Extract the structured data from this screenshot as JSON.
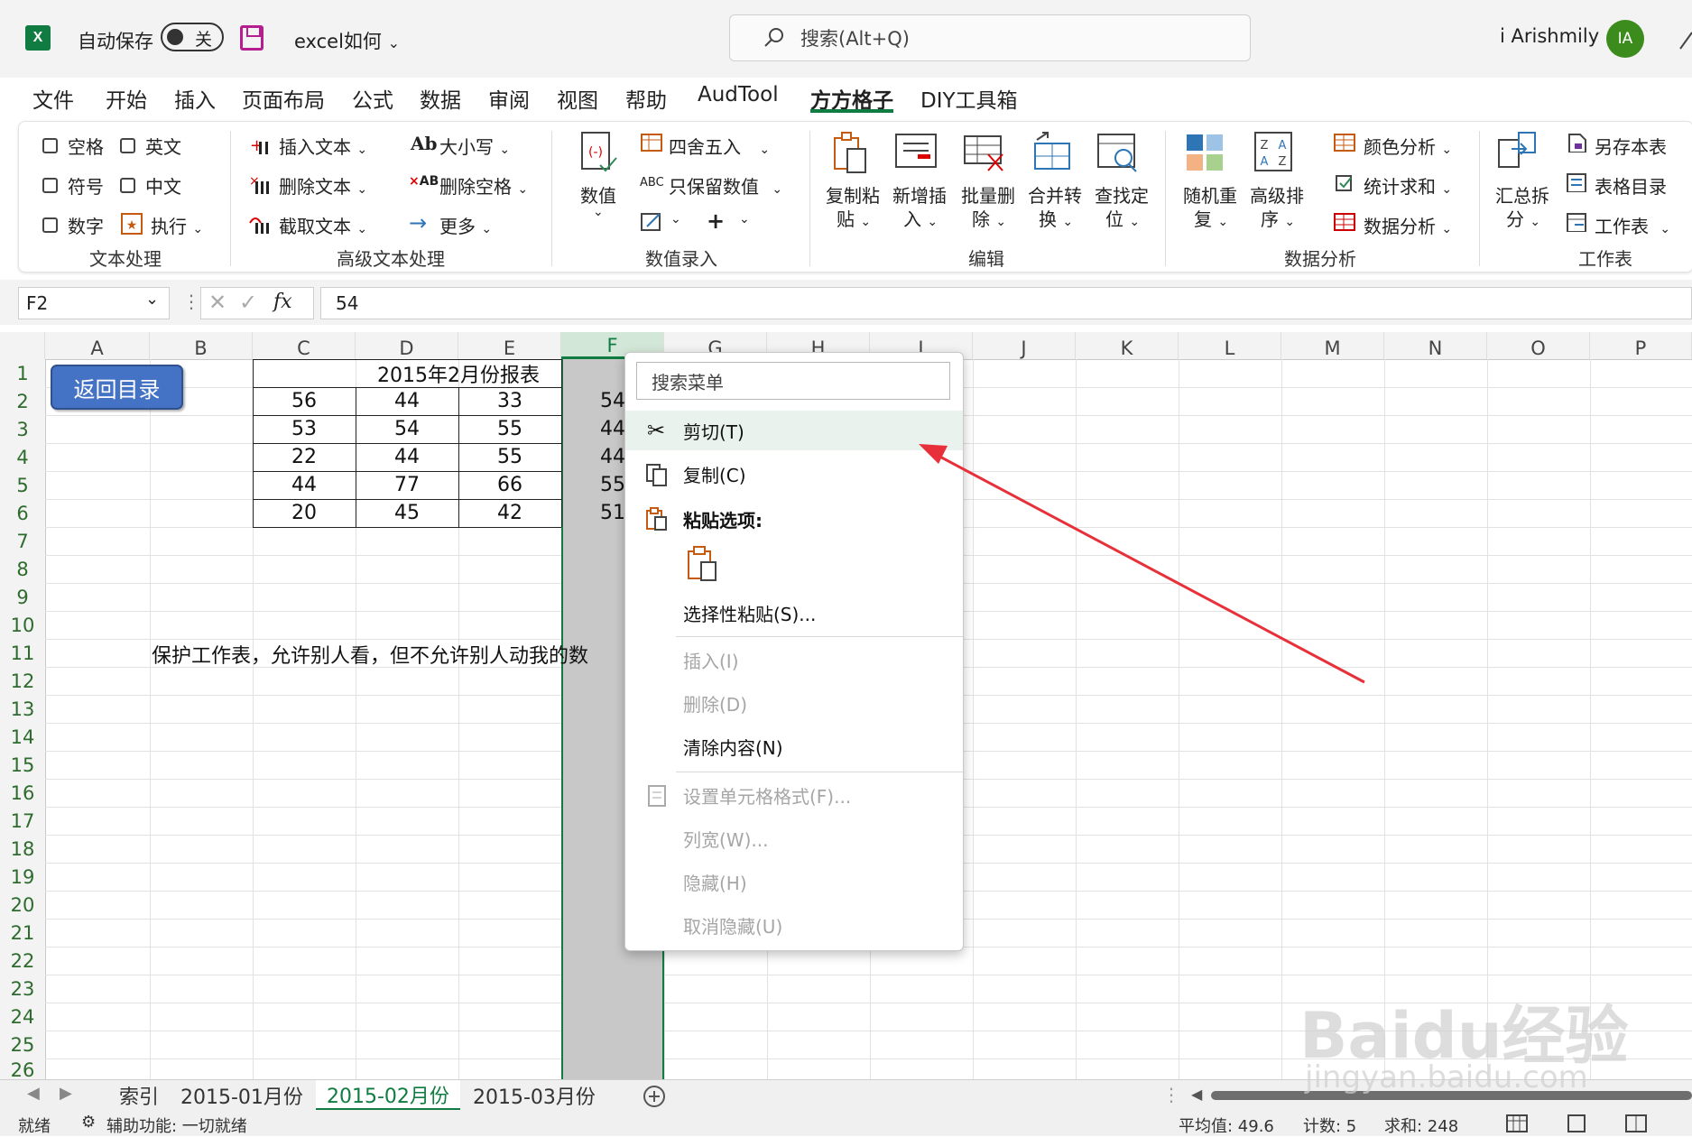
{
  "title_bar": {
    "app_badge": "X",
    "autosave_label": "自动保存",
    "autosave_state": "关",
    "file_name": "excel如何",
    "search_placeholder": "搜索(Alt+Q)",
    "user_name": "i Arishmily",
    "user_initials": "IA"
  },
  "menu_tabs": [
    "文件",
    "开始",
    "插入",
    "页面布局",
    "公式",
    "数据",
    "审阅",
    "视图",
    "帮助",
    "AudTool",
    "方方格子",
    "DIY工具箱"
  ],
  "active_menu_tab": "方方格子",
  "ribbon": {
    "text_processing": {
      "items": [
        "空格",
        "英文",
        "符号",
        "中文",
        "数字",
        "执行"
      ],
      "label": "文本处理"
    },
    "advanced_text": {
      "items": [
        "插入文本",
        "删除文本",
        "截取文本",
        "大小写",
        "删除空格",
        "更多"
      ],
      "label": "高级文本处理"
    },
    "value_entry": {
      "items": [
        "数值",
        "四舍五入",
        "只保留数值"
      ],
      "label": "数值录入"
    },
    "edit": {
      "items": [
        {
          "l1": "复制粘",
          "l2": "贴"
        },
        {
          "l1": "新增插",
          "l2": "入"
        },
        {
          "l1": "批量删",
          "l2": "除"
        },
        {
          "l1": "合并转",
          "l2": "换"
        },
        {
          "l1": "查找定",
          "l2": "位"
        }
      ],
      "label": "编辑"
    },
    "data_analysis": {
      "items": [
        {
          "l1": "随机重",
          "l2": "复"
        },
        {
          "l1": "高级排",
          "l2": "序"
        }
      ],
      "small": [
        "颜色分析",
        "统计求和",
        "数据分析"
      ],
      "label": "数据分析"
    },
    "worksheet": {
      "big": {
        "l1": "汇总拆",
        "l2": "分"
      },
      "small": [
        "另存本表",
        "表格目录",
        "工作表"
      ],
      "label": "工作表"
    }
  },
  "formula_bar": {
    "name_box": "F2",
    "fx": "fx",
    "value": "54"
  },
  "columns": [
    "A",
    "B",
    "C",
    "D",
    "E",
    "F",
    "G",
    "H",
    "I",
    "J",
    "K",
    "L",
    "M",
    "N",
    "O",
    "P"
  ],
  "rows": [
    "1",
    "2",
    "3",
    "4",
    "5",
    "6",
    "7",
    "8",
    "9",
    "10",
    "11",
    "12",
    "13",
    "14",
    "15",
    "16",
    "17",
    "18",
    "19",
    "20",
    "21",
    "22",
    "23",
    "24",
    "25",
    "26"
  ],
  "sheet": {
    "back_button": "返回目录",
    "report_title": "2015年2月份报表",
    "table": [
      [
        "56",
        "44",
        "33",
        "54"
      ],
      [
        "53",
        "54",
        "55",
        "44"
      ],
      [
        "22",
        "44",
        "55",
        "44"
      ],
      [
        "44",
        "77",
        "66",
        "55"
      ],
      [
        "20",
        "45",
        "42",
        "51"
      ]
    ],
    "note": "保护工作表，允许别人看，但不允许别人动我的数"
  },
  "context_menu": {
    "search_placeholder": "搜索菜单",
    "cut": "剪切(T)",
    "copy": "复制(C)",
    "paste_options": "粘贴选项:",
    "paste_special": "选择性粘贴(S)...",
    "insert": "插入(I)",
    "delete": "删除(D)",
    "clear": "清除内容(N)",
    "format_cells": "设置单元格格式(F)...",
    "column_width": "列宽(W)...",
    "hide": "隐藏(H)",
    "unhide": "取消隐藏(U)"
  },
  "sheet_tabs": [
    "索引",
    "2015-01月份",
    "2015-02月份",
    "2015-03月份"
  ],
  "active_sheet": "2015-02月份",
  "status_bar": {
    "ready": "就绪",
    "accessibility": "辅助功能: 一切就绪",
    "average": "平均值: 49.6",
    "count": "计数: 5",
    "sum": "求和: 248"
  },
  "watermark": {
    "logo": "Baidu经验",
    "url": "jingyan.baidu.com"
  },
  "colors": {
    "excel_green": "#107c41",
    "selection_gray": "#c8c8c8",
    "button_blue": "#4472c4",
    "arrow_red": "#e8303a"
  }
}
